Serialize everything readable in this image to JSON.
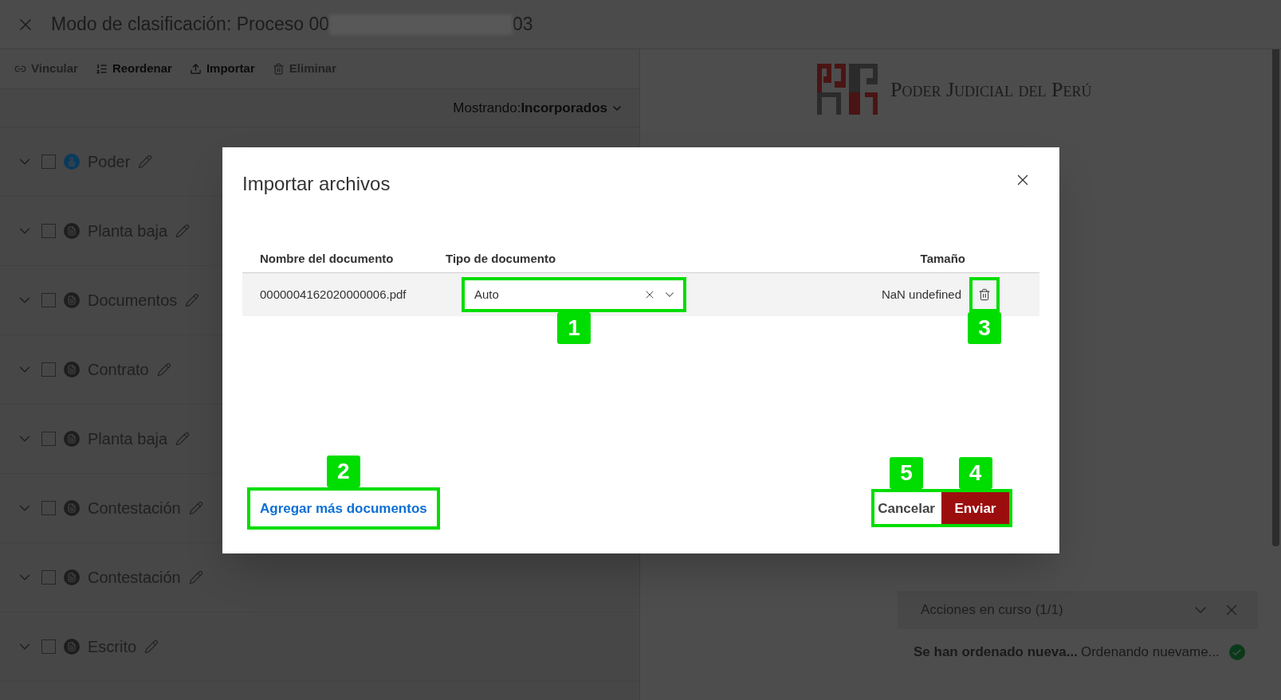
{
  "window": {
    "title_start": "Modo de clasificación: Proceso 00",
    "title_end": "03"
  },
  "toolbar": [
    {
      "label": "Vincular",
      "disabled": true
    },
    {
      "label": "Reordenar",
      "disabled": false
    },
    {
      "label": "Importar",
      "disabled": false
    },
    {
      "label": "Eliminar",
      "disabled": true
    }
  ],
  "filter": {
    "label": "Mostrando:",
    "value": "Incorporados"
  },
  "documents": [
    {
      "name": "Poder",
      "kind": "stamp",
      "checked": false
    },
    {
      "name": "Planta baja",
      "kind": "document",
      "checked": false
    },
    {
      "name": "Documentos",
      "kind": "document",
      "checked": false
    },
    {
      "name": "Contrato",
      "kind": "document",
      "checked": false
    },
    {
      "name": "Planta baja",
      "kind": "document",
      "checked": false
    },
    {
      "name": "Contestación",
      "kind": "document",
      "checked": false
    },
    {
      "name": "Contestación",
      "kind": "document",
      "checked": false
    },
    {
      "name": "Escrito",
      "kind": "document",
      "checked": false
    }
  ],
  "preview": {
    "header": "Poder Judicial del Perú"
  },
  "actions_panel": {
    "title": "Acciones en curso (1/1)",
    "items": [
      {
        "title": "Se han ordenado nueva...",
        "detail": "Ordenando nuevame...",
        "done": true
      }
    ]
  },
  "dialog": {
    "title": "Importar archivos",
    "columns": [
      "Nombre del documento",
      "Tipo de documento",
      "Tamaño"
    ],
    "rows": [
      {
        "name": "0000004162020000006.pdf",
        "type": "Auto",
        "size": "NaN undefined"
      }
    ],
    "add_link": "Agregar más documentos",
    "cancel": "Cancelar",
    "submit": "Enviar"
  },
  "callouts": {
    "type_select": "1",
    "add_link": "2",
    "delete": "3",
    "submit": "4",
    "cancel": "5"
  }
}
